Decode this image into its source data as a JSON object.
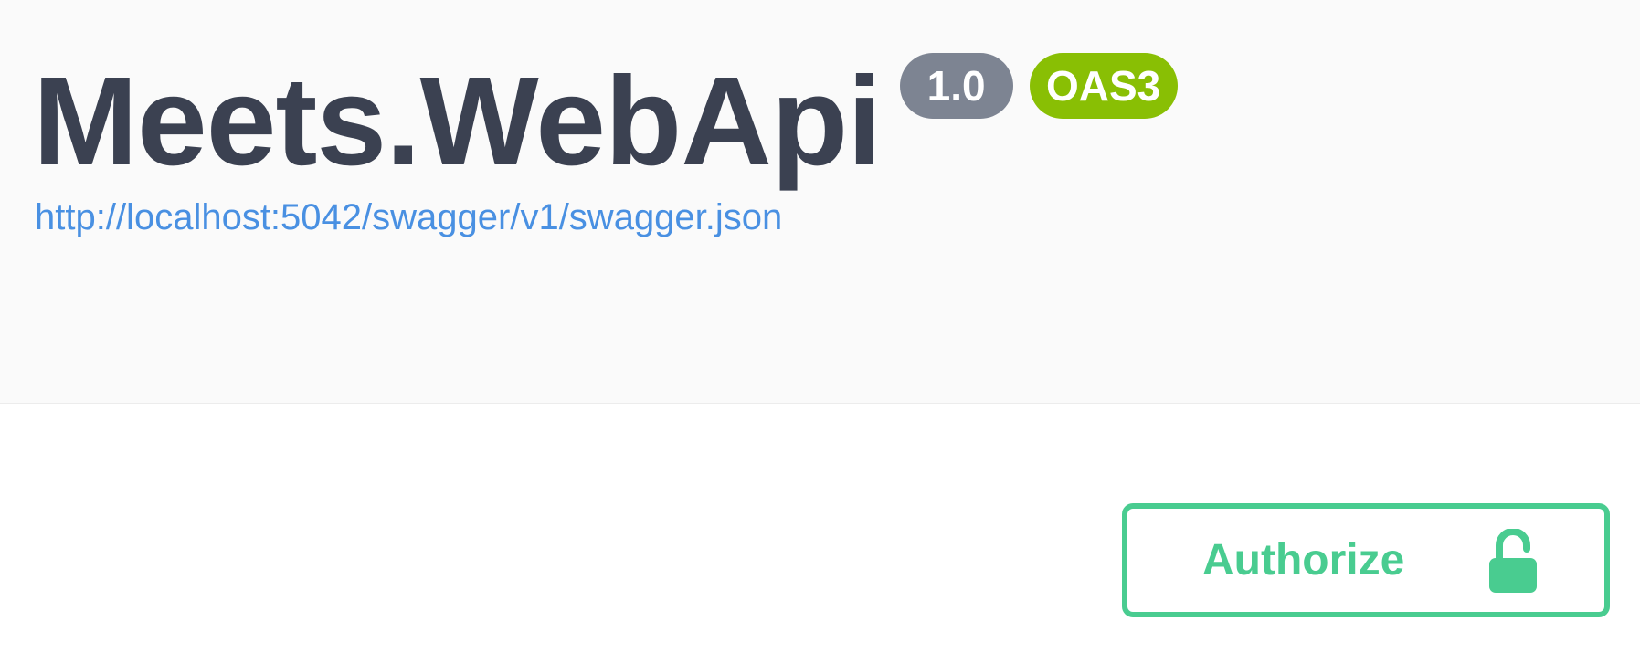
{
  "info": {
    "title": "Meets.WebApi",
    "version_badge": "1.0",
    "oas_badge": "OAS3",
    "spec_url": "http://localhost:5042/swagger/v1/swagger.json"
  },
  "auth": {
    "button_label": "Authorize",
    "icon": "unlocked-padlock-icon"
  },
  "colors": {
    "title": "#3b4151",
    "version_badge": "#7d8492",
    "oas_badge": "#89bf04",
    "link": "#4990e2",
    "authorize": "#49cc90",
    "header_bg": "#fafafa"
  }
}
